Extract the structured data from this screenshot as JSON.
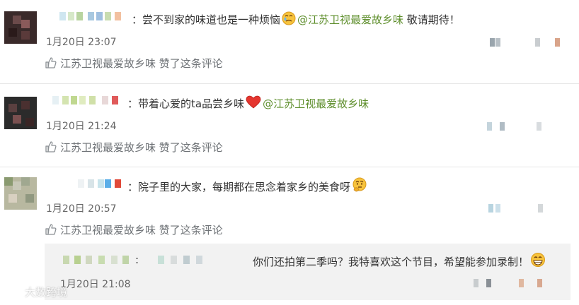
{
  "comments": [
    {
      "text": "：尝不到家的味道也是一种烦恼",
      "mention": "@江苏卫视最爱故乡味",
      "suffix": " 敬请期待！",
      "timestamp": "1月20日 23:07",
      "like_text": "江苏卫视最爱故乡味 赞了这条评论"
    },
    {
      "text": "：带着心爱的ta品尝乡味",
      "mention": "@江苏卫视最爱故乡味",
      "timestamp": "1月20日 21:24",
      "like_text": "江苏卫视最爱故乡味 赞了这条评论"
    },
    {
      "text": "：院子里的大家，每期都在思念着家乡的美食呀",
      "timestamp": "1月20日 20:57",
      "like_text": "江苏卫视最爱故乡味 赞了这条评论",
      "reply": {
        "text": "你们还拍第二季吗？我特喜欢这个节目，希望能参加录制！",
        "timestamp": "1月20日 21:08"
      }
    }
  ],
  "watermark": "大数跨境",
  "icons": {
    "like": "thumbs-up-icon",
    "emoji1": "crying-face-icon",
    "emoji2": "red-heart-icon",
    "emoji3": "thinking-face-icon",
    "emoji4": "grinning-face-icon"
  },
  "colors": {
    "mention": "#5f8f2d",
    "meta_text": "#666666",
    "like_text": "#6e7276",
    "reply_bg": "#f2f2f2"
  }
}
